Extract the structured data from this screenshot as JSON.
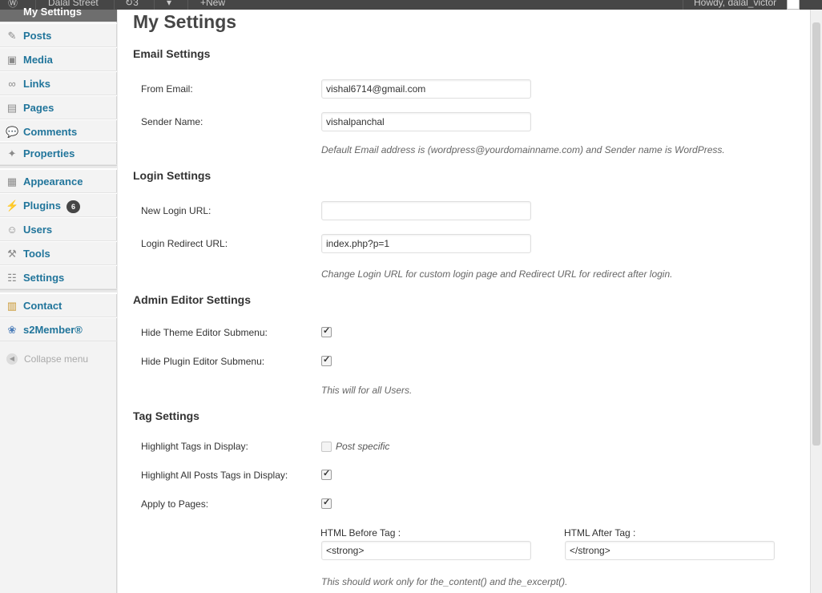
{
  "adminbar": {
    "site_name": "Dalal Street",
    "updates": "3",
    "new_label": "New",
    "howdy": "Howdy, dalal_victor"
  },
  "sidebar": {
    "current_top": "My Settings",
    "items": [
      {
        "label": "Posts",
        "icon": "pin-icon"
      },
      {
        "label": "Media",
        "icon": "media-icon"
      },
      {
        "label": "Links",
        "icon": "link-icon"
      },
      {
        "label": "Pages",
        "icon": "pages-icon"
      },
      {
        "label": "Comments",
        "icon": "comments-icon"
      },
      {
        "label": "Properties",
        "icon": "properties-icon"
      },
      {
        "label": "Appearance",
        "icon": "appearance-icon"
      },
      {
        "label": "Plugins",
        "icon": "plugins-icon",
        "badge": "6"
      },
      {
        "label": "Users",
        "icon": "users-icon"
      },
      {
        "label": "Tools",
        "icon": "tools-icon"
      },
      {
        "label": "Settings",
        "icon": "settings-icon"
      },
      {
        "label": "Contact",
        "icon": "contact-icon"
      },
      {
        "label": "s2Member®",
        "icon": "s2member-icon"
      }
    ],
    "collapse_label": "Collapse menu"
  },
  "page": {
    "title": "My Settings",
    "email": {
      "heading": "Email Settings",
      "from_label": "From Email:",
      "from_value": "vishal6714@gmail.com",
      "sender_label": "Sender Name:",
      "sender_value": "vishalpanchal",
      "note": "Default Email address is (wordpress@yourdomainname.com) and Sender name is WordPress."
    },
    "login": {
      "heading": "Login Settings",
      "new_url_label": "New Login URL:",
      "new_url_value": "",
      "redirect_label": "Login Redirect URL:",
      "redirect_value": "index.php?p=1",
      "note": "Change Login URL for custom login page and Redirect URL for redirect after login."
    },
    "admin_editor": {
      "heading": "Admin Editor Settings",
      "theme_label": "Hide Theme Editor Submenu:",
      "theme_checked": true,
      "plugin_label": "Hide Plugin Editor Submenu:",
      "plugin_checked": true,
      "note": "This will for all Users."
    },
    "tags": {
      "heading": "Tag Settings",
      "highlight_label": "Highlight Tags in Display:",
      "highlight_checked": false,
      "highlight_option": "Post specific",
      "all_posts_label": "Highlight All Posts Tags in Display:",
      "all_posts_checked": true,
      "pages_label": "Apply to Pages:",
      "pages_checked": true,
      "before_label": "HTML Before Tag :",
      "before_value": "<strong>",
      "after_label": "HTML After Tag :",
      "after_value": "</strong>",
      "note": "This should work only for the_content() and the_excerpt()."
    }
  }
}
